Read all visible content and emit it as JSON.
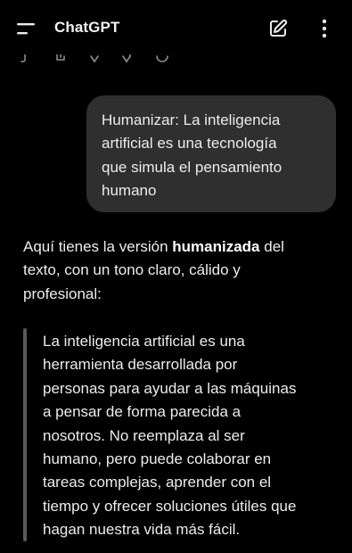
{
  "header": {
    "title": "ChatGPT",
    "menu_icon": "menu-icon",
    "edit_icon": "new-chat-icon",
    "more_icon": "more-options-icon"
  },
  "previous_message_actions": [
    "copy-icon",
    "share-icon",
    "thumbs-up-icon",
    "thumbs-down-icon",
    "regenerate-icon"
  ],
  "user_message": {
    "lines": [
      "Humanizar: La inteligencia",
      "artificial es una tecnología",
      "que simula el pensamiento",
      "humano"
    ]
  },
  "assistant_message": {
    "intro_before": "Aquí tienes la versión ",
    "intro_bold": "humanizada",
    "intro_after": " del",
    "intro_line2": "texto, con un tono claro, cálido y",
    "intro_line3": "profesional:",
    "quote_lines": [
      "La inteligencia artificial es una",
      "herramienta desarrollada por",
      "personas para ayudar a las máquinas",
      "a pensar de forma parecida a",
      "nosotros. No reemplaza al ser",
      "humano, pero puede colaborar en",
      "tareas complejas, aprender con el",
      "tiempo y ofrecer soluciones útiles que",
      "hagan nuestra vida más fácil."
    ]
  },
  "colors": {
    "background": "#000000",
    "bubble": "#2f2f2f",
    "text": "#ececec",
    "quote_bar": "#5a5a5a"
  }
}
